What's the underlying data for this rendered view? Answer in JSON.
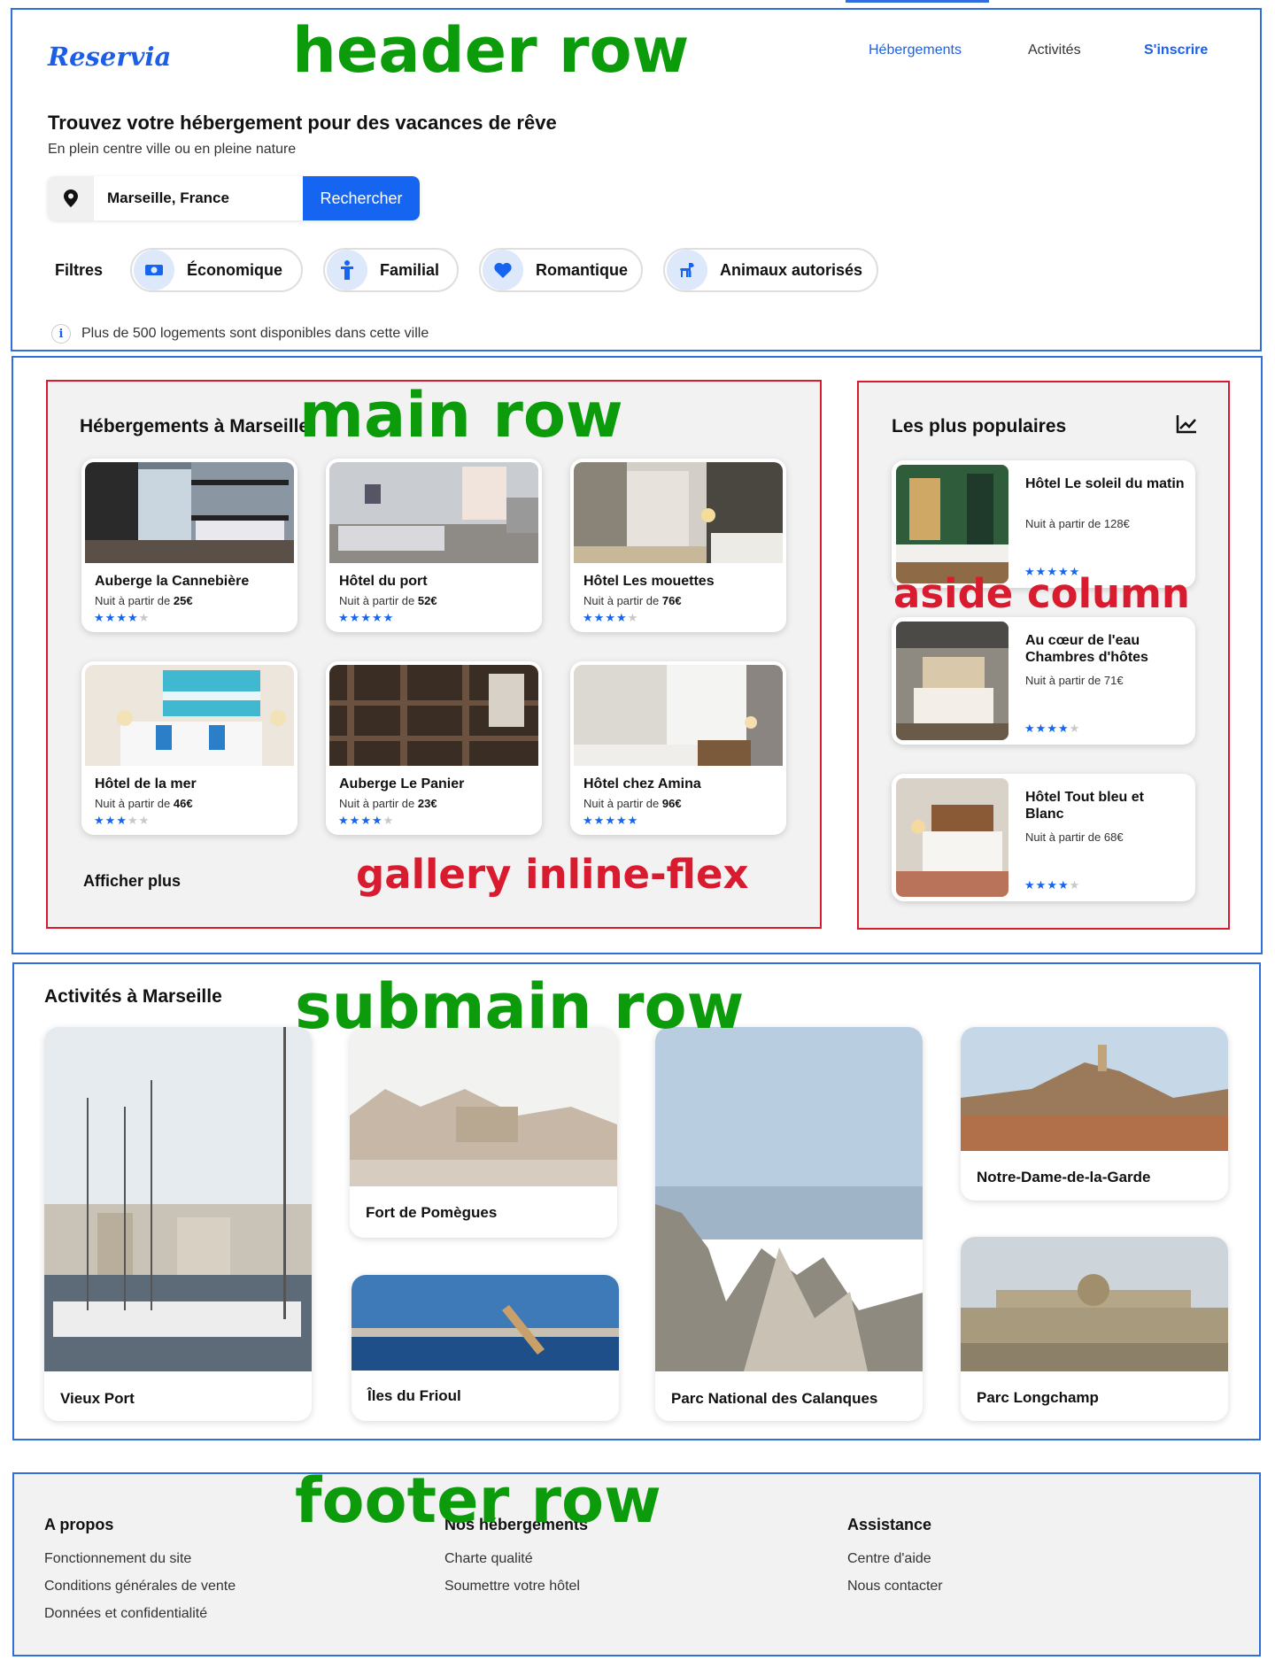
{
  "header": {
    "logo": "Reservia",
    "nav": {
      "hebergements": "Hébergements",
      "activites": "Activités",
      "inscrire": "S'inscrire"
    },
    "title": "Trouvez votre hébergement pour des vacances de rêve",
    "subtitle": "En plein centre ville ou en pleine nature",
    "search": {
      "value": "Marseille, France",
      "button": "Rechercher"
    },
    "filters_label": "Filtres",
    "filters": [
      "Économique",
      "Familial",
      "Romantique",
      "Animaux autorisés"
    ],
    "info": "Plus de 500 logements sont disponibles dans cette ville"
  },
  "annotations": {
    "header_row": "header row",
    "main_row": "main row",
    "aside_column": "aside column",
    "gallery": "gallery inline-flex",
    "submain_row": "submain row",
    "footer_row": "footer row"
  },
  "main": {
    "title": "Hébergements à Marseille",
    "price_prefix": "Nuit à partir de",
    "cards": [
      {
        "name": "Auberge la Cannebière",
        "price": "25€",
        "rating": 4
      },
      {
        "name": "Hôtel du port",
        "price": "52€",
        "rating": 5
      },
      {
        "name": "Hôtel Les mouettes",
        "price": "76€",
        "rating": 4
      },
      {
        "name": "Hôtel de la mer",
        "price": "46€",
        "rating": 3
      },
      {
        "name": "Auberge Le Panier",
        "price": "23€",
        "rating": 4
      },
      {
        "name": "Hôtel chez Amina",
        "price": "96€",
        "rating": 5
      }
    ],
    "more": "Afficher plus"
  },
  "aside": {
    "title": "Les plus populaires",
    "items": [
      {
        "name": "Hôtel Le soleil du matin",
        "price": "Nuit à partir de 128€",
        "rating": 5
      },
      {
        "name": "Au cœur de l'eau Chambres d'hôtes",
        "price": "Nuit à partir de 71€",
        "rating": 4
      },
      {
        "name": "Hôtel Tout bleu et Blanc",
        "price": "Nuit à partir de 68€",
        "rating": 4
      }
    ]
  },
  "activities": {
    "title": "Activités à Marseille",
    "items": [
      "Vieux Port",
      "Fort de Pomègues",
      "Îles du Frioul",
      "Parc National des Calanques",
      "Notre-Dame-de-la-Garde",
      "Parc Longchamp"
    ]
  },
  "footer": {
    "cols": [
      {
        "title": "A propos",
        "links": [
          "Fonctionnement du site",
          "Conditions générales de vente",
          "Données et confidentialité"
        ]
      },
      {
        "title": "Nos hébergements",
        "links": [
          "Charte qualité",
          "Soumettre votre hôtel"
        ]
      },
      {
        "title": "Assistance",
        "links": [
          "Centre d'aide",
          "Nous contacter"
        ]
      }
    ]
  },
  "colors": {
    "primary": "#1565f0",
    "panel": "#f2f2f2",
    "star_off": "#c8c8c8",
    "frame_blue": "#2f6fdd",
    "frame_red": "#d81b2f",
    "annotation_green": "#0b9b0b"
  }
}
